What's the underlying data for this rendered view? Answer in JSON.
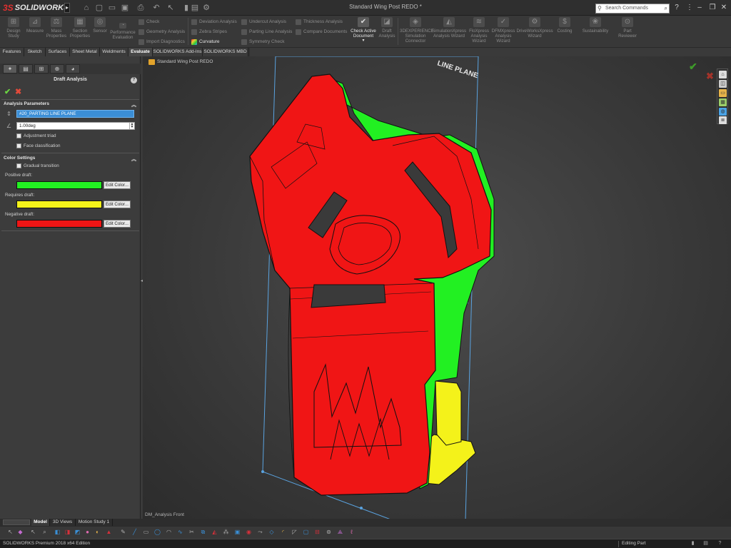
{
  "app": {
    "logo_mark": "3S",
    "logo_text": "SOLIDWORKS",
    "document_title": "Standard Wing Post REDO *",
    "search_placeholder": "Search Commands"
  },
  "commands": {
    "large": [
      {
        "name": "design-study",
        "label": "Design\nStudy",
        "icon": "design-study-icon"
      },
      {
        "name": "measure",
        "label": "Measure",
        "icon": "measure-icon"
      },
      {
        "name": "mass-properties",
        "label": "Mass\nProperties",
        "icon": "mass-properties-icon"
      },
      {
        "name": "section-properties",
        "label": "Section\nProperties",
        "icon": "section-properties-icon"
      },
      {
        "name": "sensor",
        "label": "Sensor",
        "icon": "sensor-icon"
      },
      {
        "name": "performance-evaluation",
        "label": "Performance\nEvaluation",
        "icon": "performance-icon"
      }
    ],
    "small_col1": [
      "Check",
      "Geometry Analysis",
      "Import Diagnostics"
    ],
    "small_col2": [
      "Deviation Analysis",
      "Zebra Stripes",
      "Curvature"
    ],
    "small_col3": [
      "Undercut Analysis",
      "Parting Line Analysis",
      "Symmetry Check"
    ],
    "small_col4": [
      "Thickness Analysis",
      "Compare Documents"
    ],
    "check_active": "Check Active\nDocument",
    "draft_analysis": "Draft\nAnalysis",
    "large_right": [
      {
        "name": "3dexperience",
        "label": "3DEXPERIENCE\nSimulation\nConnector"
      },
      {
        "name": "simulationxpress",
        "label": "SimulationXpress\nAnalysis Wizard"
      },
      {
        "name": "floxpress",
        "label": "FloXpress\nAnalysis\nWizard"
      },
      {
        "name": "dfmxpress",
        "label": "DFMXpress\nAnalysis\nWizard"
      },
      {
        "name": "driveworksxpress",
        "label": "DriveWorksXpress\nWizard"
      },
      {
        "name": "costing",
        "label": "Costing"
      },
      {
        "name": "sustainability",
        "label": "Sustainability"
      },
      {
        "name": "part-reviewer",
        "label": "Part\nReviewer"
      }
    ]
  },
  "tabs": [
    "Features",
    "Sketch",
    "Surfaces",
    "Sheet Metal",
    "Weldments",
    "Evaluate",
    "SOLIDWORKS Add-Ins",
    "SOLIDWORKS MBD"
  ],
  "active_tab": "Evaluate",
  "property_manager": {
    "title": "Draft Analysis",
    "analysis_parameters": "Analysis Parameters",
    "direction_value": "#20_PARTING LINE PLANE",
    "angle_value": "1.00deg",
    "adjustment_triad": "Adjustment triad",
    "face_classification": "Face classification",
    "color_settings": "Color Settings",
    "gradual_transition": "Gradual transition",
    "positive_label": "Positive draft:",
    "requires_label": "Requires draft:",
    "negative_label": "Negative draft:",
    "edit_color": "Edit Color...",
    "colors": {
      "positive": "#22f022",
      "requires": "#f4f21a",
      "negative": "#f01515"
    }
  },
  "viewport": {
    "part_name": "Standard Wing Post REDO",
    "view_label": "DM_Analysis Front",
    "plane_label": "LINE PLANE"
  },
  "bottom_tabs": [
    "Model",
    "3D Views",
    "Motion Study 1"
  ],
  "status": {
    "edition": "SOLIDWORKS Premium 2018 x64 Edition",
    "mode": "Editing Part"
  }
}
